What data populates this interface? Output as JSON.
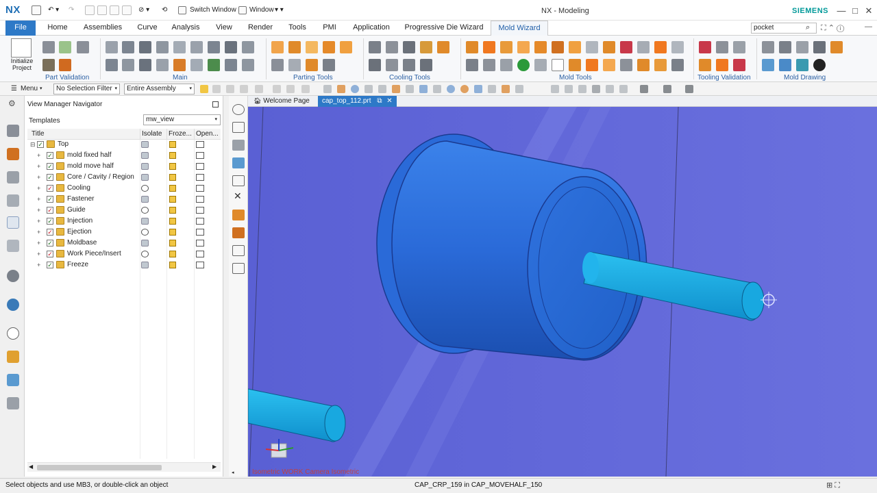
{
  "app": {
    "logo": "NX",
    "title": "NX - Modeling",
    "brand": "SIEMENS",
    "switch_window": "Switch Window",
    "window_menu": "Window"
  },
  "tabs": [
    "File",
    "Home",
    "Assemblies",
    "Curve",
    "Analysis",
    "View",
    "Render",
    "Tools",
    "PMI",
    "Application",
    "Progressive Die Wizard",
    "Mold Wizard"
  ],
  "active_tab": "Mold Wizard",
  "search": {
    "value": "pocket"
  },
  "ribbon": {
    "initialize_label": "Initialize\nProject",
    "groups": [
      "Part Validation",
      "Main",
      "Parting Tools",
      "Cooling Tools",
      "Mold Tools",
      "Tooling Validation",
      "Mold Drawing"
    ]
  },
  "command_bar": {
    "menu_label": "Menu",
    "selection_filter": "No Selection Filter",
    "scope": "Entire Assembly"
  },
  "navigator": {
    "title": "View Manager Navigator",
    "templates_label": "Templates",
    "template_value": "mw_view",
    "columns": [
      "Title",
      "Isolate",
      "Froze...",
      "Open..."
    ],
    "root": "Top",
    "rows": [
      {
        "label": "mold fixed half",
        "red": false,
        "eye": false
      },
      {
        "label": "mold move half",
        "red": false,
        "eye": false
      },
      {
        "label": "Core / Cavity / Region",
        "red": false,
        "eye": false
      },
      {
        "label": "Cooling",
        "red": true,
        "eye": true
      },
      {
        "label": "Fastener",
        "red": false,
        "eye": false
      },
      {
        "label": "Guide",
        "red": true,
        "eye": true
      },
      {
        "label": "Injection",
        "red": false,
        "eye": false
      },
      {
        "label": "Ejection",
        "red": true,
        "eye": true
      },
      {
        "label": "Moldbase",
        "red": false,
        "eye": false
      },
      {
        "label": "Work Piece/Insert",
        "red": true,
        "eye": true
      },
      {
        "label": "Freeze",
        "red": false,
        "eye": false
      }
    ]
  },
  "doc_tabs": [
    "Welcome Page",
    "cap_top_112.prt"
  ],
  "viewport": {
    "background": "#5f65d8",
    "label": "Isometric WORK Camera Isometric"
  },
  "status": {
    "left": "Select objects and use MB3, or double-click an object",
    "middle": "CAP_CRP_159 in CAP_MOVEHALF_150"
  }
}
